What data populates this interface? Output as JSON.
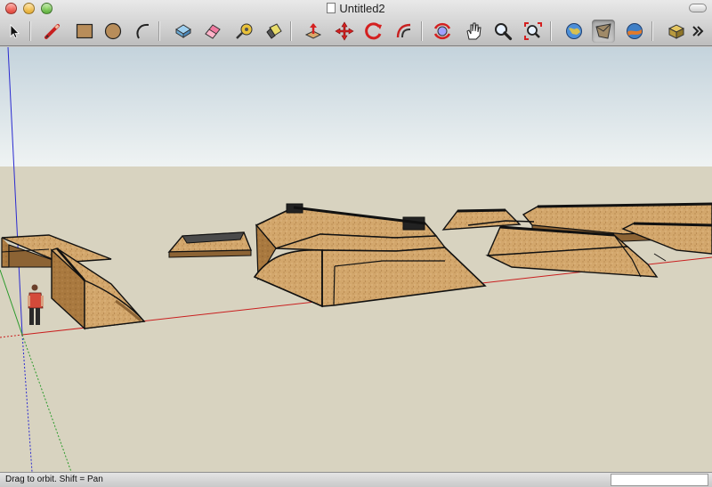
{
  "window": {
    "title": "Untitled2"
  },
  "toolbar": {
    "tools": [
      {
        "name": "select-tool",
        "icon": "arrow-cursor-icon",
        "active": false
      },
      {
        "name": "pencil-tool",
        "icon": "pencil-icon",
        "active": false
      },
      {
        "name": "rectangle-tool",
        "icon": "rectangle-icon",
        "active": false
      },
      {
        "name": "circle-tool",
        "icon": "circle-icon",
        "active": false
      },
      {
        "name": "arc-tool",
        "icon": "arc-icon",
        "active": false
      },
      {
        "name": "make-component-tool",
        "icon": "component-icon",
        "active": false
      },
      {
        "name": "eraser-tool",
        "icon": "eraser-icon",
        "active": false
      },
      {
        "name": "tape-measure-tool",
        "icon": "tape-measure-icon",
        "active": false
      },
      {
        "name": "paint-bucket-tool",
        "icon": "paint-bucket-icon",
        "active": false
      },
      {
        "name": "push-pull-tool",
        "icon": "push-pull-icon",
        "active": false
      },
      {
        "name": "move-tool",
        "icon": "move-arrows-icon",
        "active": false
      },
      {
        "name": "rotate-tool",
        "icon": "rotate-icon",
        "active": false
      },
      {
        "name": "offset-tool",
        "icon": "offset-icon",
        "active": false
      },
      {
        "name": "orbit-tool",
        "icon": "orbit-icon",
        "active": false
      },
      {
        "name": "pan-tool",
        "icon": "hand-icon",
        "active": false
      },
      {
        "name": "zoom-tool",
        "icon": "magnifier-icon",
        "active": false
      },
      {
        "name": "zoom-extents-tool",
        "icon": "zoom-extents-icon",
        "active": false
      },
      {
        "name": "get-models-tool",
        "icon": "globe-icon",
        "active": false
      },
      {
        "name": "share-model-tool",
        "icon": "share-icon",
        "active": true
      },
      {
        "name": "google-earth-tool",
        "icon": "earth-icon",
        "active": false
      },
      {
        "name": "extension-warehouse-tool",
        "icon": "extension-icon",
        "active": false
      }
    ]
  },
  "scene": {
    "sky_top": "#c4d3dc",
    "sky_bottom": "#eff3f3",
    "ground": "#d8d3c0",
    "ramp_face": "#d3a76c",
    "ramp_shadow": "#8c6334",
    "axis_red": "#c91f1f",
    "axis_blue": "#2a2ad0",
    "axis_green": "#2a9a2a"
  },
  "status": {
    "message": "Drag to orbit.  Shift = Pan",
    "measurements": ""
  }
}
